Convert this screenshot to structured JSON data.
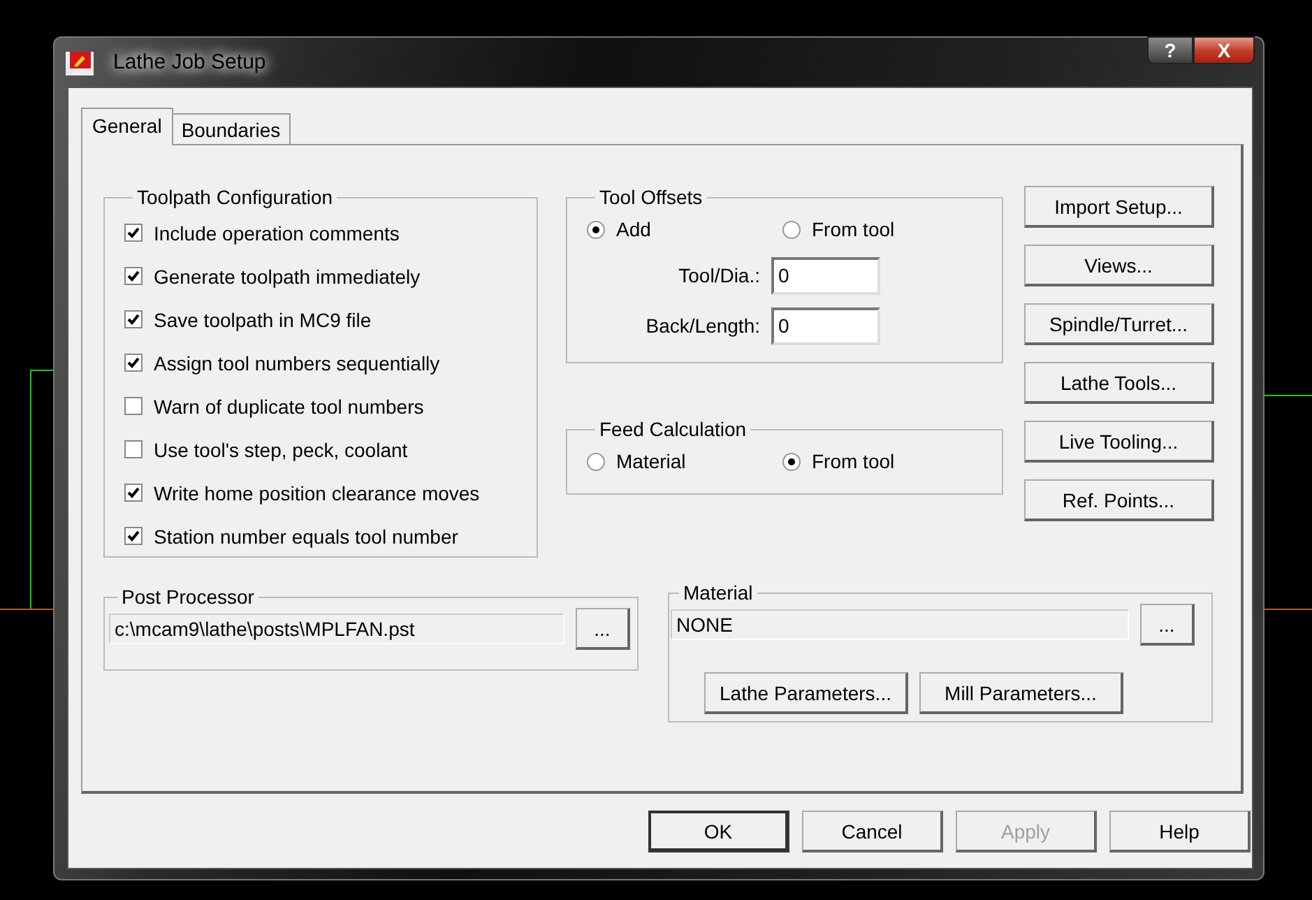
{
  "window": {
    "title": "Lathe Job Setup",
    "help_button": "?",
    "close_button": "X"
  },
  "tabs": [
    {
      "label": "General",
      "selected": true
    },
    {
      "label": "Boundaries",
      "selected": false
    }
  ],
  "toolpath_configuration": {
    "title": "Toolpath Configuration",
    "options": [
      {
        "label": "Include operation comments",
        "checked": true
      },
      {
        "label": "Generate toolpath immediately",
        "checked": true
      },
      {
        "label": "Save toolpath in MC9 file",
        "checked": true
      },
      {
        "label": "Assign tool numbers sequentially",
        "checked": true
      },
      {
        "label": "Warn of duplicate tool numbers",
        "checked": false
      },
      {
        "label": "Use tool's step, peck, coolant",
        "checked": false
      },
      {
        "label": "Write home position clearance moves",
        "checked": true
      },
      {
        "label": "Station number equals tool number",
        "checked": true
      }
    ]
  },
  "tool_offsets": {
    "title": "Tool Offsets",
    "options": [
      {
        "label": "Add",
        "selected": true
      },
      {
        "label": "From tool",
        "selected": false
      }
    ],
    "fields": [
      {
        "label": "Tool/Dia.:",
        "value": "0"
      },
      {
        "label": "Back/Length:",
        "value": "0"
      }
    ]
  },
  "feed_calculation": {
    "title": "Feed Calculation",
    "options": [
      {
        "label": "Material",
        "selected": false
      },
      {
        "label": "From tool",
        "selected": true
      }
    ]
  },
  "side_buttons": [
    "Import Setup...",
    "Views...",
    "Spindle/Turret...",
    "Lathe Tools...",
    "Live Tooling...",
    "Ref. Points..."
  ],
  "post_processor": {
    "title": "Post Processor",
    "value": "c:\\mcam9\\lathe\\posts\\MPLFAN.pst",
    "browse": "..."
  },
  "material": {
    "title": "Material",
    "value": "NONE",
    "browse": "...",
    "buttons": [
      "Lathe Parameters...",
      "Mill Parameters..."
    ]
  },
  "dialog_buttons": [
    {
      "label": "OK",
      "disabled": false
    },
    {
      "label": "Cancel",
      "disabled": false
    },
    {
      "label": "Apply",
      "disabled": true
    },
    {
      "label": "Help",
      "disabled": false
    }
  ]
}
